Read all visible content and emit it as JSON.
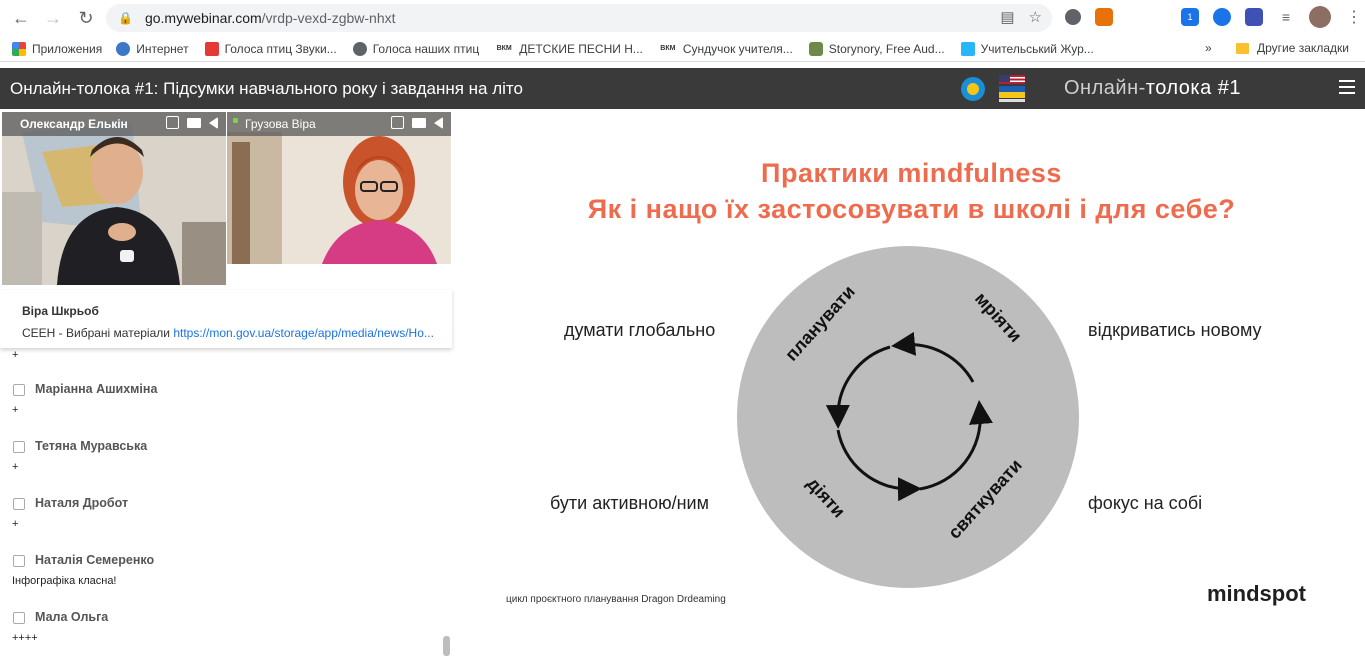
{
  "browser": {
    "url_host": "go.mywebinar.com",
    "url_path": "/vrdp-vexd-zgbw-nhxt",
    "bookmarks": [
      {
        "label": "Приложения",
        "icon": "apps-grid-icon"
      },
      {
        "label": "Интернет",
        "icon": "globe-icon"
      },
      {
        "label": "Голоса птиц Звуки...",
        "icon": "bird-sounds-icon"
      },
      {
        "label": "Голоса наших птиц",
        "icon": "globe-icon"
      },
      {
        "label": "ДЕТСКИЕ ПЕСНИ Н...",
        "icon": "bkm-icon"
      },
      {
        "label": "Сундучок учителя...",
        "icon": "bkm-icon"
      },
      {
        "label": "Storynory, Free Aud...",
        "icon": "storynory-icon"
      },
      {
        "label": "Учительський Жур...",
        "icon": "journal-icon"
      }
    ],
    "bookmarks_more": "»",
    "other_bookmarks": "Другие закладки",
    "ext_badge": "1"
  },
  "webinar": {
    "title": "Онлайн-толока #1: Підсумки навчального року і завдання на літо",
    "brand_a": "Онлайн-",
    "brand_b": "толока #1"
  },
  "videos": [
    {
      "name": "Олександр Елькін"
    },
    {
      "name": "Грузова Віра"
    }
  ],
  "notice": {
    "name": "Віра Шкрьоб",
    "message": "СЕЕН - Вибрані матеріали ",
    "link": "https://mon.gov.ua/storage/app/media/news/Ho..."
  },
  "chat": {
    "top_text": "+",
    "entries": [
      {
        "author": "Маріанна Ашихміна",
        "text": "+"
      },
      {
        "author": "Тетяна Муравська",
        "text": "+"
      },
      {
        "author": "Наталя Дробот",
        "text": "+"
      },
      {
        "author": "Наталія Семеренко",
        "text": "Інфографіка класна!"
      },
      {
        "author": "Мала Ольга",
        "text": "++++"
      }
    ]
  },
  "slide": {
    "title_line1": "Практики mindfulness",
    "title_line2": "Як і нащо їх застосовувати в школі і для себе?",
    "left_top": "думати глобально",
    "right_top": "відкриватись новому",
    "left_bottom": "бути активною/ним",
    "right_bottom": "фокус на собі",
    "circle_words": [
      "планувати",
      "мріяти",
      "діяти",
      "святкувати"
    ],
    "caption": "цикл проєктного планування Dragon Drdeaming",
    "logo": "mindspot",
    "accent_color": "#ef6b4e",
    "circle_color": "#bdbdbd"
  }
}
